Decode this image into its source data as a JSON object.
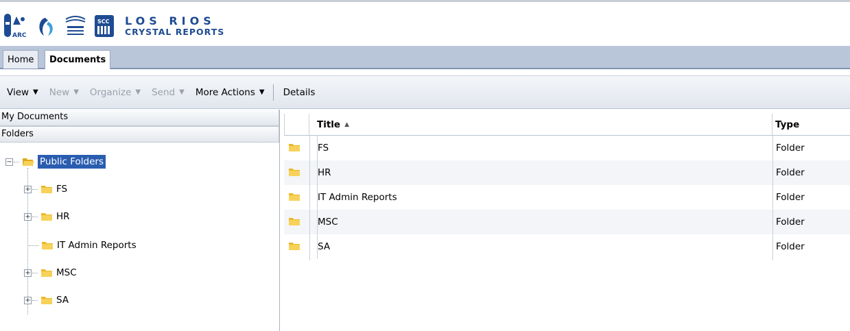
{
  "header": {
    "logos": [
      "ARC",
      "Cosumnes River College",
      "Lake Tahoe College",
      "SCC"
    ],
    "brand_line1": "LOS RIOS",
    "brand_line2": "CRYSTAL REPORTS",
    "brand_color": "#1e4b93"
  },
  "tabs": [
    {
      "label": "Home"
    },
    {
      "label": "Documents"
    }
  ],
  "toolbar": {
    "view": "View",
    "new": "New",
    "organize": "Organize",
    "send": "Send",
    "more_actions": "More Actions",
    "details": "Details"
  },
  "left": {
    "my_documents": "My Documents",
    "folders": "Folders",
    "root": "Public Folders",
    "children": [
      {
        "label": "FS",
        "expandable": true
      },
      {
        "label": "HR",
        "expandable": true
      },
      {
        "label": "IT Admin Reports",
        "expandable": false
      },
      {
        "label": "MSC",
        "expandable": true
      },
      {
        "label": "SA",
        "expandable": true
      }
    ]
  },
  "list": {
    "columns": {
      "title": "Title",
      "type": "Type"
    },
    "rows": [
      {
        "title": "FS",
        "type": "Folder"
      },
      {
        "title": "HR",
        "type": "Folder"
      },
      {
        "title": "IT Admin Reports",
        "type": "Folder"
      },
      {
        "title": "MSC",
        "type": "Folder"
      },
      {
        "title": "SA",
        "type": "Folder"
      }
    ]
  },
  "colors": {
    "selection": "#2a5db0",
    "folder": "#f2c12e",
    "tabbar": "#b9c6d9"
  }
}
